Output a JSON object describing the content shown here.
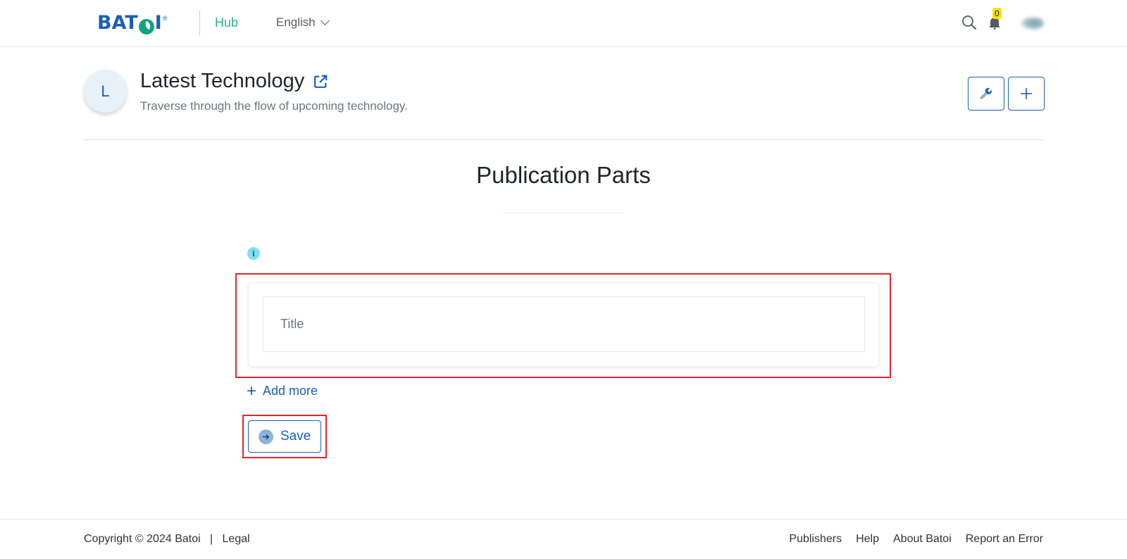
{
  "header": {
    "logo_text_left": "BAT",
    "logo_text_right": "I",
    "logo_reg": "®",
    "hub_label": "Hub",
    "language": "English",
    "notification_count": "0",
    "icons": {
      "search": "search-icon",
      "bell": "bell-icon",
      "avatar": "user-avatar"
    }
  },
  "publication": {
    "initial": "L",
    "title": "Latest Technology",
    "description": "Traverse through the flow of upcoming technology.",
    "actions": [
      "wrench-icon",
      "plus-icon"
    ]
  },
  "main": {
    "title": "Publication Parts",
    "info_icon": "i",
    "parts": [
      {
        "value": "",
        "placeholder": "Title"
      }
    ],
    "add_more_label": "Add more",
    "save_label": "Save"
  },
  "footer": {
    "copyright": "Copyright © 2024 Batoi",
    "separator": "|",
    "legal": "Legal",
    "links": [
      "Publishers",
      "Help",
      "About Batoi",
      "Report an Error"
    ]
  },
  "colors": {
    "brand_blue": "#1a5fb4",
    "brand_green": "#25b38e",
    "highlight_red": "#e5262b",
    "badge_yellow": "#f5e400"
  }
}
